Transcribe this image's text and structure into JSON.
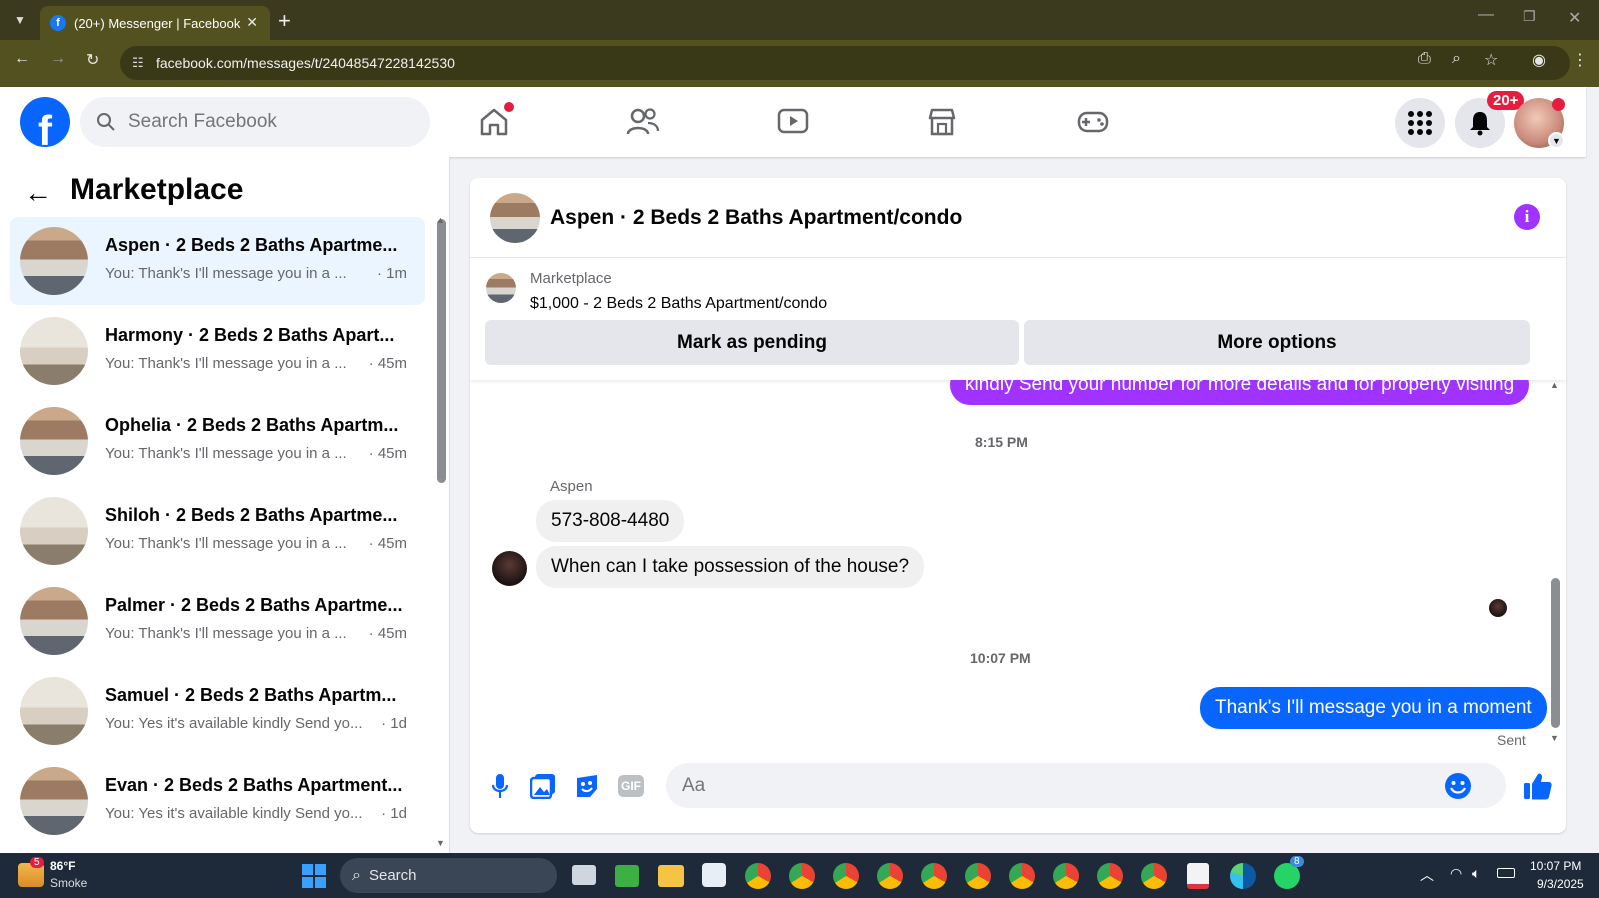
{
  "browser": {
    "tab_title": "(20+) Messenger | Facebook",
    "url": "facebook.com/messages/t/24048547228142530"
  },
  "header": {
    "search_placeholder": "Search Facebook",
    "notification_badge": "20+",
    "nav_icons": [
      "home-icon",
      "friends-icon",
      "video-icon",
      "marketplace-icon",
      "gaming-icon"
    ]
  },
  "sidebar": {
    "title": "Marketplace",
    "conversations": [
      {
        "name": "Aspen · 2 Beds 2 Baths Apartme...",
        "preview": "You: Thank's I'll message you in a ...",
        "time": "· 1m",
        "active": true
      },
      {
        "name": "Harmony · 2 Beds 2 Baths Apart...",
        "preview": "You: Thank's I'll message you in a ...",
        "time": "· 45m"
      },
      {
        "name": "Ophelia · 2 Beds 2 Baths Apartm...",
        "preview": "You: Thank's I'll message you in a ...",
        "time": "· 45m"
      },
      {
        "name": "Shiloh · 2 Beds 2 Baths Apartme...",
        "preview": "You: Thank's I'll message you in a ...",
        "time": "· 45m"
      },
      {
        "name": "Palmer · 2 Beds 2 Baths Apartme...",
        "preview": "You: Thank's I'll message you in a ...",
        "time": "· 45m"
      },
      {
        "name": "Samuel · 2 Beds 2 Baths Apartm...",
        "preview": "You: Yes it's available kindly Send yo...",
        "time": "· 1d"
      },
      {
        "name": "Evan · 2 Beds 2 Baths Apartment...",
        "preview": "You: Yes it's available kindly Send yo...",
        "time": "· 1d"
      }
    ]
  },
  "chat": {
    "title": "Aspen · 2 Beds 2 Baths Apartment/condo",
    "marketplace_label": "Marketplace",
    "listing": "$1,000 - 2 Beds 2 Baths Apartment/condo",
    "mark_pending": "Mark as pending",
    "more_options": "More options",
    "msg_partial": "kindly Send your number for more details and for property visiting",
    "ts1": "8:15 PM",
    "sender": "Aspen",
    "msg_phone": "573-808-4480",
    "msg_question": "When can I take possession of the house?",
    "ts2": "10:07 PM",
    "msg_reply": "Thank's I'll message you in a moment",
    "sent_status": "Sent",
    "input_placeholder": "Aa"
  },
  "taskbar": {
    "weather_temp": "86°F",
    "weather_desc": "Smoke",
    "weather_badge": "5",
    "search_label": "Search",
    "clock_time": "10:07 PM",
    "clock_date": "9/3/2025",
    "whatsapp_badge": "8"
  },
  "colors": {
    "fb_blue": "#0866ff",
    "messenger_purple": "#a033ff",
    "notif_red": "#e41e3f"
  }
}
